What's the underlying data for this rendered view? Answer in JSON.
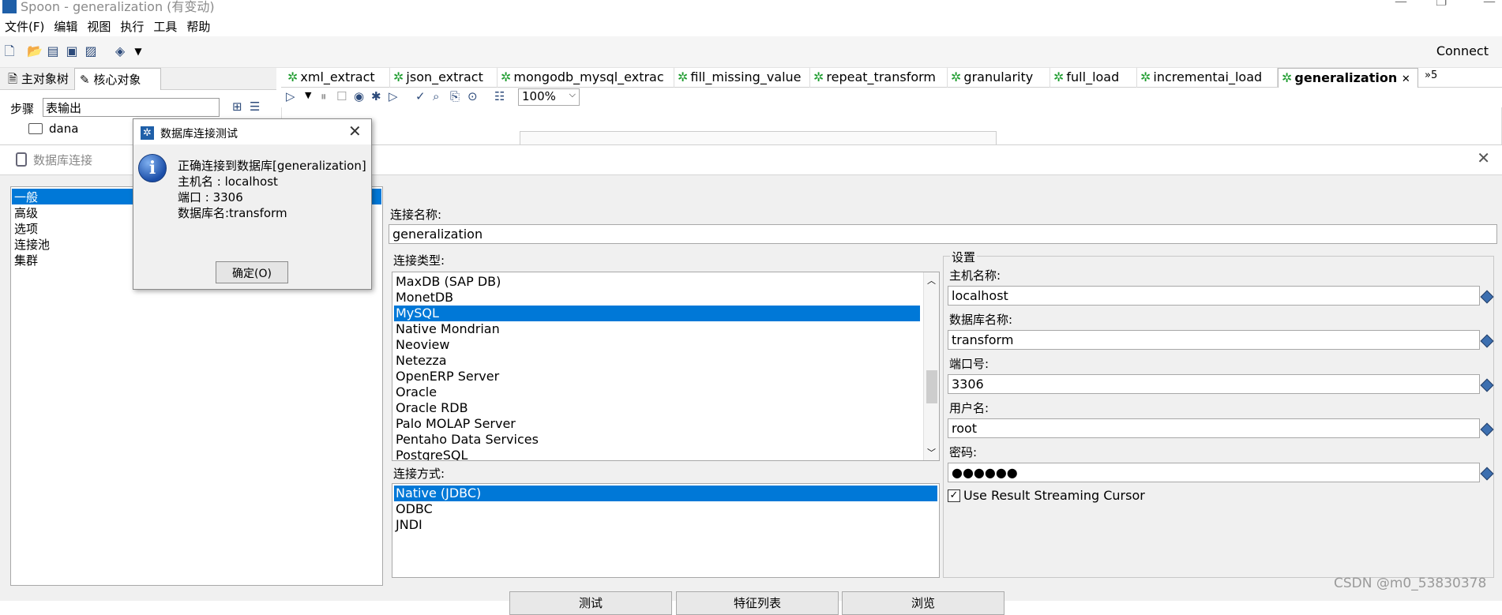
{
  "app": {
    "title": "Spoon - generalization (有变动)",
    "window_controls": [
      "—",
      "❐",
      "—"
    ],
    "accent_color": "#0078d7"
  },
  "menu": [
    "文件(F)",
    "编辑",
    "视图",
    "执行",
    "工具",
    "帮助"
  ],
  "toolbar": {
    "icons": [
      "new-file-icon",
      "open-folder-icon",
      "explore-icon",
      "save-icon",
      "save-as-icon",
      "layers-icon",
      "dropdown-icon"
    ],
    "connect_label": "Connect"
  },
  "left_panel": {
    "tabs": [
      "主对象树",
      "核心对象"
    ],
    "steps_label": "步骤",
    "steps_value": "表输出",
    "tree_item": "dana"
  },
  "editor_tabs": [
    "xml_extract",
    "json_extract",
    "mongodb_mysql_extrac",
    "fill_missing_value",
    "repeat_transform",
    "granularity",
    "full_load",
    "incrementai_load",
    "generalization"
  ],
  "editor_tabs_more": "»5",
  "zoom": "100%",
  "db_dialog": {
    "title": "数据库连接",
    "categories": [
      "一般",
      "高级",
      "选项",
      "连接池",
      "集群"
    ],
    "selected_category": "一般",
    "conn_name_label": "连接名称:",
    "conn_name_value": "generalization",
    "conn_type_label": "连接类型:",
    "conn_types": [
      "MaxDB (SAP DB)",
      "MonetDB",
      "MySQL",
      "Native Mondrian",
      "Neoview",
      "Netezza",
      "OpenERP Server",
      "Oracle",
      "Oracle RDB",
      "Palo MOLAP Server",
      "Pentaho Data Services",
      "PostgreSQL"
    ],
    "selected_conn_type": "MySQL",
    "access_label": "连接方式:",
    "access_types": [
      "Native (JDBC)",
      "ODBC",
      "JNDI"
    ],
    "selected_access": "Native (JDBC)",
    "settings": {
      "legend": "设置",
      "host_label": "主机名称:",
      "host_value": "localhost",
      "db_label": "数据库名称:",
      "db_value": "transform",
      "port_label": "端口号:",
      "port_value": "3306",
      "user_label": "用户名:",
      "user_value": "root",
      "password_label": "密码:",
      "password_value": "●●●●●●",
      "streaming_label": "Use Result Streaming Cursor",
      "streaming_checked": true
    },
    "buttons": [
      "测试",
      "特征列表",
      "浏览"
    ]
  },
  "msg_dialog": {
    "title": "数据库连接测试",
    "lines": [
      "正确连接到数据库[generalization]",
      "主机名      : localhost",
      "端口         : 3306",
      "数据库名:transform"
    ],
    "ok_label": "确定(O)"
  },
  "watermark": "CSDN @m0_53830378"
}
